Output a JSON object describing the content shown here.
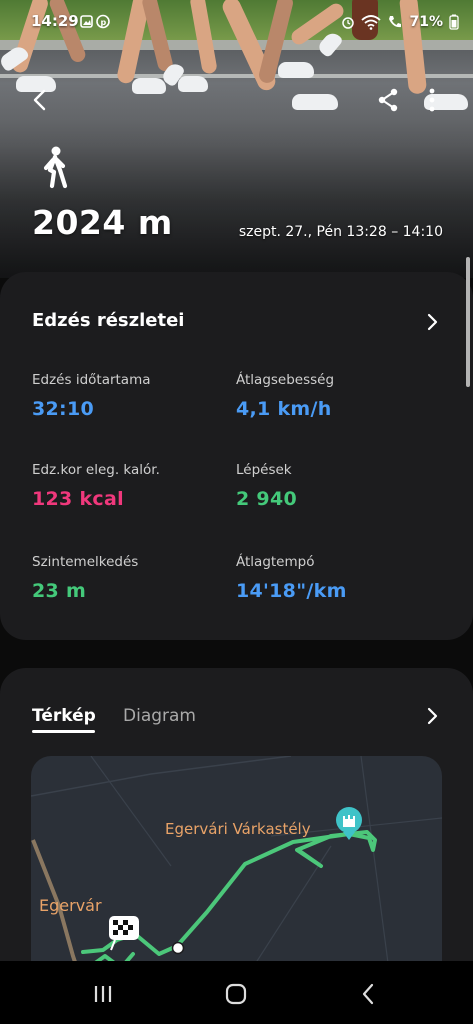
{
  "status": {
    "time": "14:29",
    "battery": "71%"
  },
  "hero": {
    "distance": "2024 m",
    "date_range": "szept. 27., Pén 13:28 – 14:10"
  },
  "details": {
    "title": "Edzés részletei",
    "metrics": [
      {
        "label": "Edzés időtartama",
        "value": "32:10",
        "color": "#4a9bf5"
      },
      {
        "label": "Átlagsebesség",
        "value": "4,1 km/h",
        "color": "#4a9bf5"
      },
      {
        "label": "Edz.kor eleg. kalór.",
        "value": "123 kcal",
        "color": "#f0387c"
      },
      {
        "label": "Lépések",
        "value": "2 940",
        "color": "#44c97a"
      },
      {
        "label": "Szintemelkedés",
        "value": "23 m",
        "color": "#44c97a"
      },
      {
        "label": "Átlagtempó",
        "value": "14'18\"/km",
        "color": "#4a9bf5"
      }
    ]
  },
  "map_card": {
    "tabs": [
      "Térkép",
      "Diagram"
    ],
    "active_tab": "Térkép",
    "labels": {
      "castle": "Egervári Várkastély",
      "village": "Egervár"
    },
    "route_color": "#4cc77a",
    "label_color": "#e9a368"
  },
  "icons": {
    "back": "back-arrow-icon",
    "share": "share-icon",
    "more": "more-vertical-icon",
    "activity": "walking-person-icon",
    "chevron": "chevron-right-icon"
  }
}
